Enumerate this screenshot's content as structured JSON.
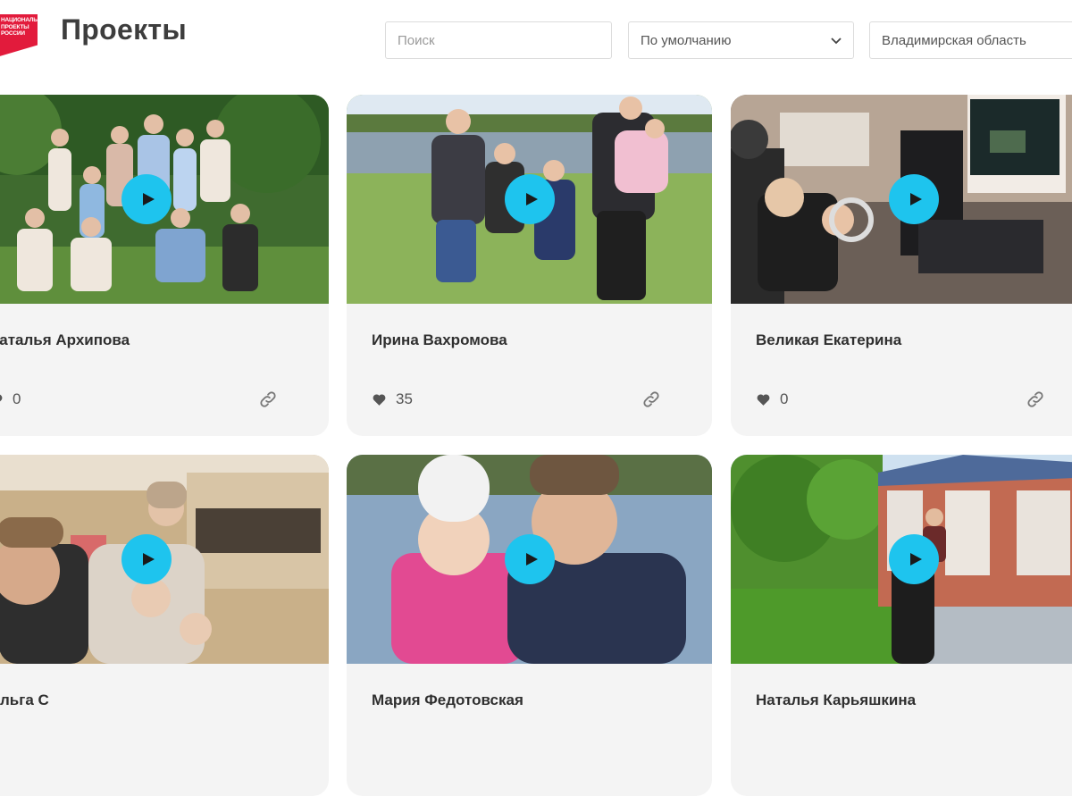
{
  "header": {
    "logo_lines": [
      "НАЦИОНАЛЬНЫЕ",
      "ПРОЕКТЫ",
      "РОССИИ"
    ],
    "title": "Проекты",
    "search_placeholder": "Поиск",
    "sort_value": "По умолчанию",
    "region_value": "Владимирская область"
  },
  "colors": {
    "accent": "#1ec4ee",
    "brand_red": "#e21b3c",
    "card_bg": "#f4f4f4"
  },
  "icons": {
    "play": "play-icon",
    "like": "heart-icon",
    "share": "link-icon",
    "sort": "chevron-down-icon"
  },
  "cards": [
    {
      "name": "Наталья Архипова",
      "likes": "0"
    },
    {
      "name": "Ирина Вахромова",
      "likes": "35"
    },
    {
      "name": "Великая Екатерина",
      "likes": "0"
    },
    {
      "name": "Ольга С",
      "likes": ""
    },
    {
      "name": "Мария Федотовская",
      "likes": ""
    },
    {
      "name": "Наталья Карьяшкина",
      "likes": ""
    }
  ]
}
